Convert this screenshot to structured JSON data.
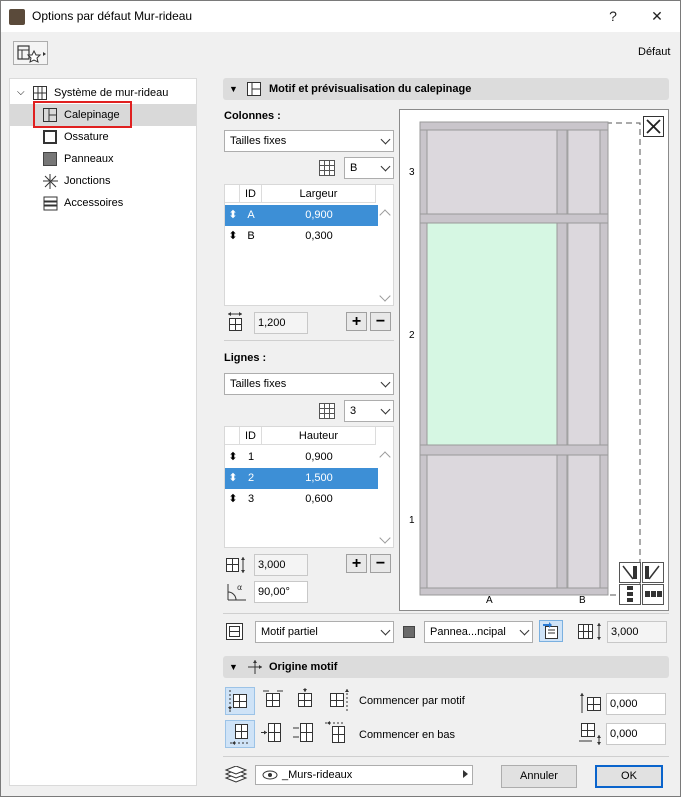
{
  "window": {
    "title": "Options par défaut Mur-rideau",
    "help": "?",
    "close": "✕"
  },
  "toolbar": {
    "default_label": "Défaut"
  },
  "tree": {
    "root": "Système de mur-rideau",
    "items": [
      {
        "label": "Calepinage",
        "icon": "grid-pattern-icon",
        "selected": true
      },
      {
        "label": "Ossature",
        "icon": "frame-icon"
      },
      {
        "label": "Panneaux",
        "icon": "panel-icon"
      },
      {
        "label": "Jonctions",
        "icon": "junction-icon"
      },
      {
        "label": "Accessoires",
        "icon": "accessory-icon"
      }
    ]
  },
  "pattern_section": {
    "title": "Motif et prévisualisation du calepinage"
  },
  "columns": {
    "label": "Colonnes :",
    "mode": "Tailles fixes",
    "count": "B",
    "headers": {
      "id": "ID",
      "value": "Largeur"
    },
    "rows": [
      {
        "id": "A",
        "value": "0,900",
        "selected": true
      },
      {
        "id": "B",
        "value": "0,300",
        "selected": false
      }
    ],
    "total": "1,200"
  },
  "rows": {
    "label": "Lignes :",
    "mode": "Tailles fixes",
    "count": "3",
    "headers": {
      "id": "ID",
      "value": "Hauteur"
    },
    "rows": [
      {
        "id": "1",
        "value": "0,900",
        "selected": false
      },
      {
        "id": "2",
        "value": "1,500",
        "selected": true
      },
      {
        "id": "3",
        "value": "0,600",
        "selected": false
      }
    ],
    "total": "3,000",
    "angle": "90,00°"
  },
  "preview": {
    "row_labels": [
      "3",
      "2",
      "1"
    ],
    "col_labels": [
      "A",
      "B"
    ],
    "colors": {
      "panel": "#dcd8dd",
      "selected_panel": "#d6f7e3",
      "frame": "#c9c5cb"
    }
  },
  "bottom_row": {
    "pattern_mode": "Motif partiel",
    "panel_select": "Pannea...ncipal",
    "height": "3,000"
  },
  "origin_section": {
    "title": "Origine motif",
    "start_pattern_label": "Commencer par motif",
    "start_pattern_value": "0,000",
    "start_bottom_label": "Commencer en bas",
    "start_bottom_value": "0,000"
  },
  "footer": {
    "layer": "_Murs-rideaux",
    "cancel": "Annuler",
    "ok": "OK"
  }
}
